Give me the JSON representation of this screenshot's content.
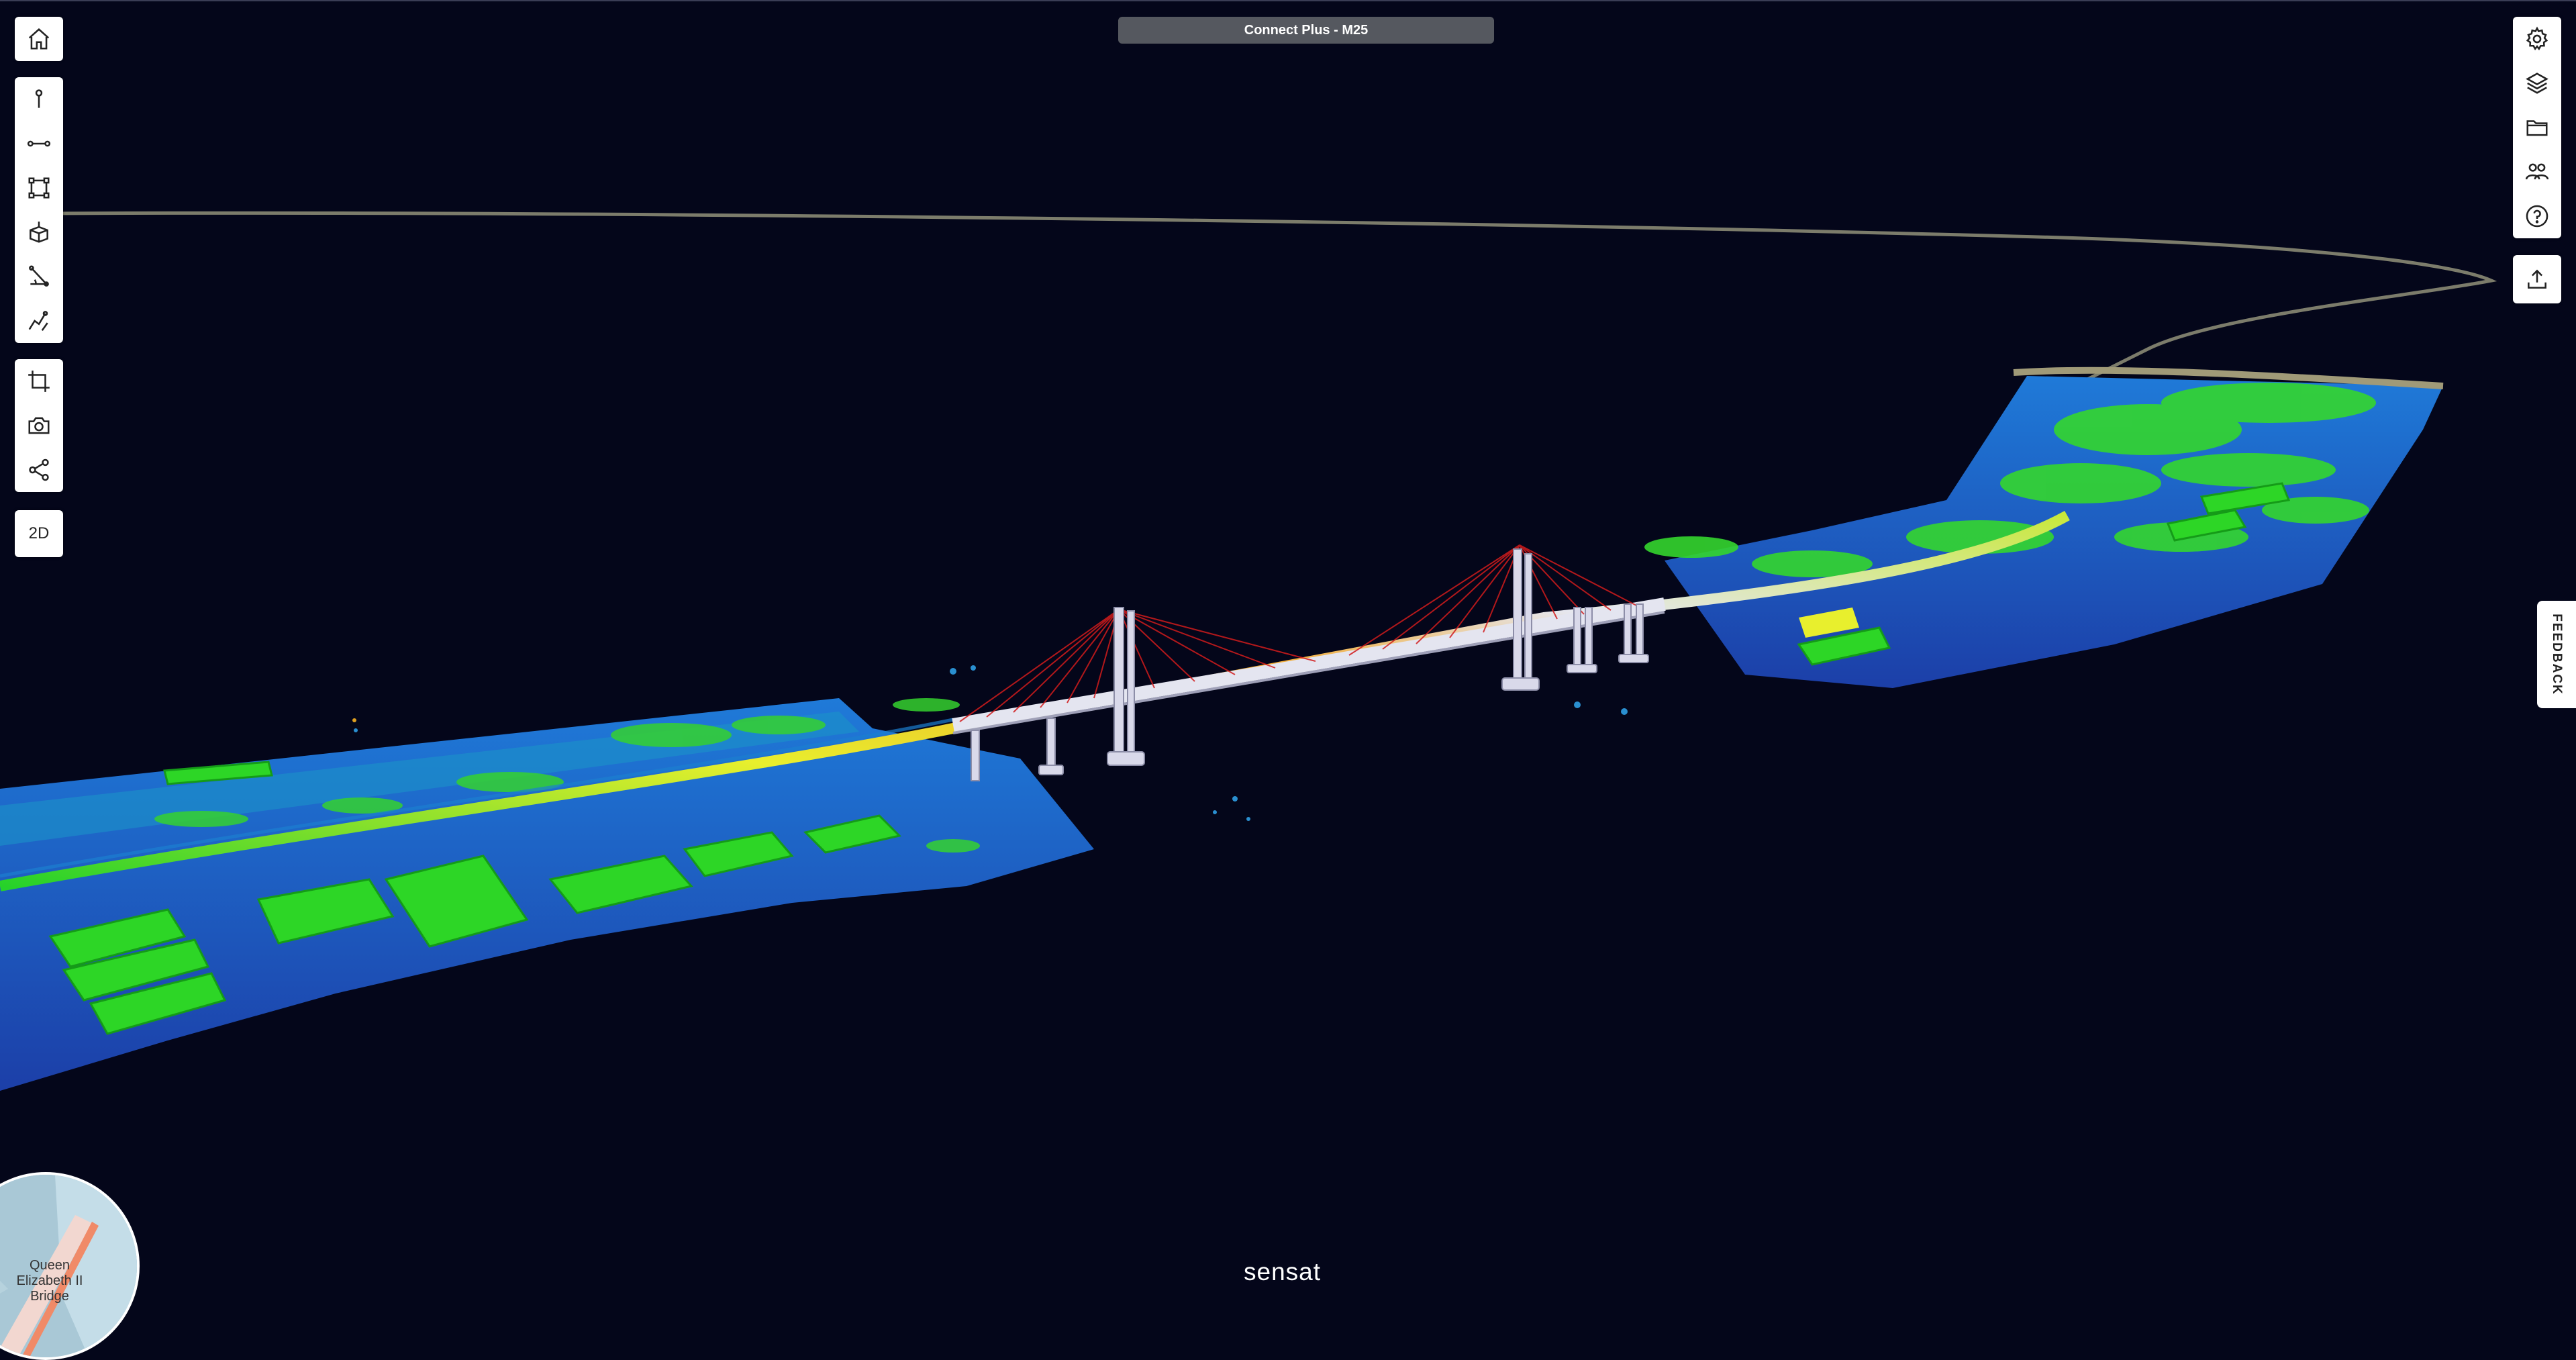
{
  "project_title": "Connect Plus - M25",
  "left_toolbar": {
    "home": "home-icon",
    "measure_tools": [
      "point-marker-icon",
      "distance-line-icon",
      "area-polygon-icon",
      "volume-icon",
      "angle-icon",
      "profile-icon"
    ],
    "capture_tools": [
      "crop-icon",
      "camera-icon",
      "share-icon"
    ],
    "view_toggle_label": "2D"
  },
  "right_toolbar": {
    "tools": [
      "settings-gear-icon",
      "layers-icon",
      "folder-icon",
      "users-icon",
      "help-icon"
    ],
    "upload": "upload-icon"
  },
  "feedback_label": "FEEDBACK",
  "minimap": {
    "label": "Queen Elizabeth II Bridge"
  },
  "brand": "sensat",
  "colors": {
    "background": "#04061a",
    "toolbar": "#ffffff",
    "title_pill": "#55585f",
    "pointcloud_low": "#1f55c8",
    "pointcloud_mid": "#1fd11f",
    "pointcloud_high": "#e6ef2a",
    "cables": "#d21c1c",
    "bridge_structure": "#d9d9ea"
  }
}
